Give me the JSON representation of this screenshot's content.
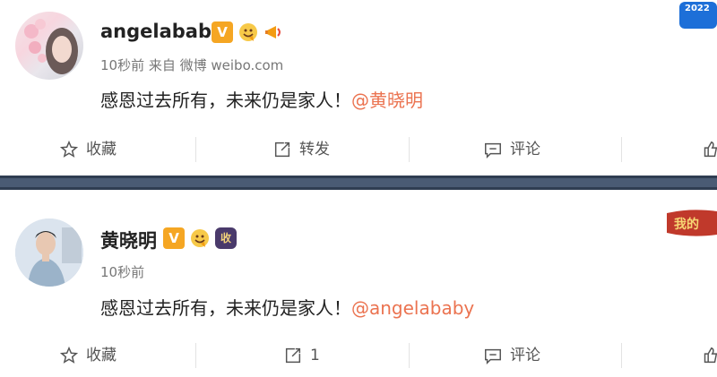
{
  "posts": [
    {
      "username": "angelababy",
      "meta": "10秒前 来自 微博 weibo.com",
      "content_text": "感恩过去所有，未来仍是家人！",
      "mention": "@黄晓明",
      "actions": {
        "favorite": "收藏",
        "repost": "转发",
        "comment": "评论"
      }
    },
    {
      "username": "黄晓明",
      "meta": "10秒前",
      "content_text": "感恩过去所有，未来仍是家人！",
      "mention": "@angelababy",
      "actions": {
        "favorite": "收藏",
        "repost": "1",
        "comment": "评论"
      }
    }
  ],
  "badges": {
    "verified": "V",
    "collect": "收"
  },
  "corner_labels": {
    "top": "2022",
    "bottom": "我的"
  },
  "colors": {
    "mention": "#eb7350",
    "verified": "#f5a623",
    "divider": "#2f3d52"
  }
}
